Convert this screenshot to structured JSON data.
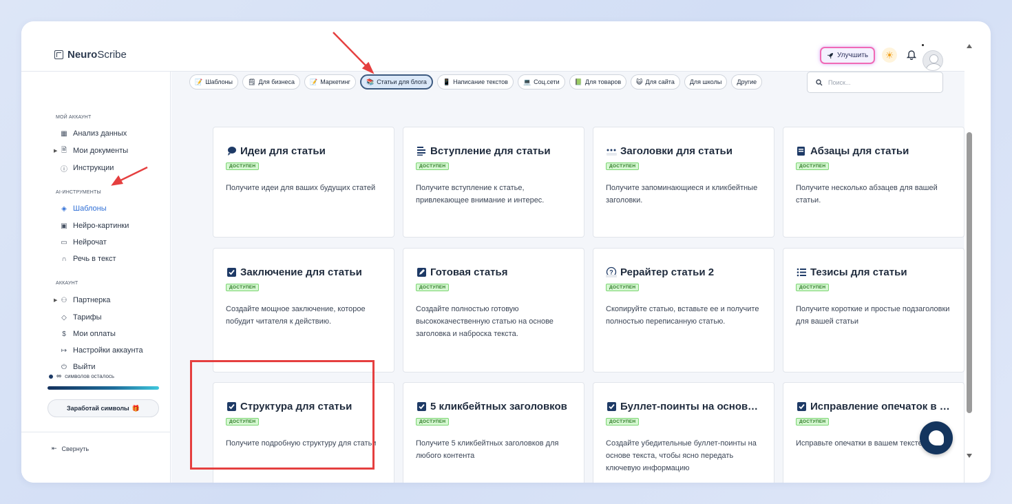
{
  "app": {
    "logo_bold": "Neuro",
    "logo_light": "Scribe"
  },
  "header": {
    "upgrade_label": "Улучшить"
  },
  "sidebar": {
    "section_account": "МОЙ АККАУНТ",
    "items_account": [
      {
        "label": "Анализ данных",
        "icon": "grid-icon"
      },
      {
        "label": "Мои документы",
        "icon": "document-icon"
      },
      {
        "label": "Инструкции",
        "icon": "help-icon"
      }
    ],
    "section_ai": "AI-ИНСТРУМЕНТЫ",
    "items_ai": [
      {
        "label": "Шаблоны",
        "icon": "layers-icon",
        "active": true
      },
      {
        "label": "Нейро-картинки",
        "icon": "image-icon"
      },
      {
        "label": "Нейрочат",
        "icon": "chat-icon"
      },
      {
        "label": "Речь в текст",
        "icon": "headphones-icon"
      }
    ],
    "section_acc2": "АККАУНТ",
    "items_acc2": [
      {
        "label": "Партнерка",
        "icon": "users-icon"
      },
      {
        "label": "Тарифы",
        "icon": "tag-icon"
      },
      {
        "label": "Мои оплаты",
        "icon": "dollar-icon"
      },
      {
        "label": "Настройки аккаунта",
        "icon": "settings-icon"
      },
      {
        "label": "Выйти",
        "icon": "power-icon"
      }
    ],
    "credits_symbol": "∞",
    "credits_text": "символов осталось",
    "credits_fill_fraction": 1.0,
    "earn_label": "Заработай символы",
    "collapse_label": "Свернуть"
  },
  "tabs": [
    {
      "label": "Шаблоны",
      "icon": "📝"
    },
    {
      "label": "Для бизнеса",
      "icon": "🗒"
    },
    {
      "label": "Маркетинг",
      "icon": "📝"
    },
    {
      "label": "Статьи для блога",
      "icon": "📚",
      "active": true
    },
    {
      "label": "Написание текстов",
      "icon": "📱"
    },
    {
      "label": "Соц.сети",
      "icon": "💻"
    },
    {
      "label": "Для товаров",
      "icon": "📗"
    },
    {
      "label": "Для сайта",
      "icon": "😺"
    },
    {
      "label": "Для школы",
      "icon": ""
    },
    {
      "label": "Другие",
      "icon": ""
    }
  ],
  "search": {
    "placeholder": "Поиск..."
  },
  "badge_label": "ДОСТУПЕН",
  "cards": [
    {
      "title": "Идеи для статьи",
      "desc": "Получите идеи для ваших будущих статей"
    },
    {
      "title": "Вступление для статьи",
      "desc": "Получите вступление к статье, привлекающее внимание и интерес."
    },
    {
      "title": "Заголовки для статьи",
      "desc": "Получите запоминающиеся и кликбейтные заголовки."
    },
    {
      "title": "Абзацы для статьи",
      "desc": "Получите несколько абзацев для вашей статьи."
    },
    {
      "title": "Заключение для статьи",
      "desc": "Создайте мощное заключение, которое побудит читателя к действию."
    },
    {
      "title": "Готовая статья",
      "desc": "Создайте полностью готовую высококачественную статью на основе заголовка и наброска текста."
    },
    {
      "title": "Рерайтер статьи 2",
      "desc": "Скопируйте статью, вставьте ее и получите полностью переписанную статью."
    },
    {
      "title": "Тезисы для статьи",
      "desc": "Получите короткие и простые подзаголовки для вашей статьи"
    },
    {
      "title": "Структура для статьи",
      "desc": "Получите подробную структуру для статьи"
    },
    {
      "title": "5 кликбейтных заголовков",
      "desc": "Получите 5 кликбейтных заголовков для любого контента"
    },
    {
      "title": "Буллет-поинты на основе текста",
      "desc": "Создайте убедительные буллет-поинты на основе текста, чтобы ясно передать ключевую информацию"
    },
    {
      "title": "Исправление опечаток в тексте",
      "desc": "Исправьте опечатки в вашем тексте"
    }
  ],
  "colors": {
    "accent": "#2f6fd6",
    "badge_bg": "#d6f7d2",
    "highlight": "#e53f3f",
    "chat": "#14355e"
  }
}
